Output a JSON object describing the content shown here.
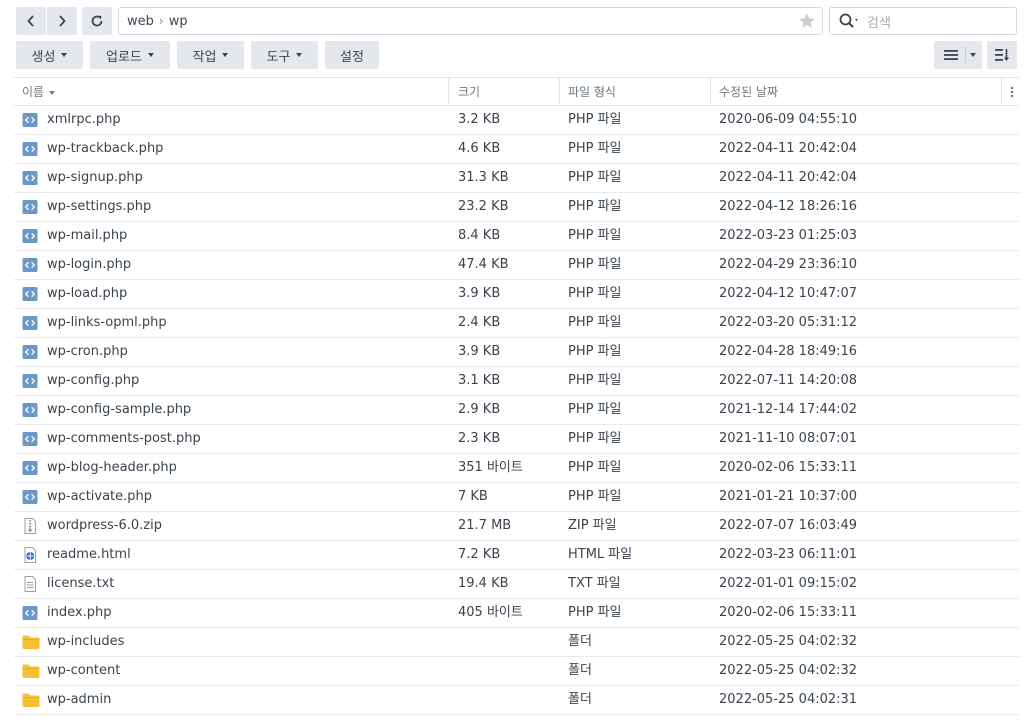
{
  "nav": {
    "path": [
      "web",
      "wp"
    ],
    "path_separator": "›",
    "search_placeholder": "검색"
  },
  "toolbar": {
    "create_label": "생성",
    "upload_label": "업로드",
    "action_label": "작업",
    "tools_label": "도구",
    "settings_label": "설정"
  },
  "table": {
    "columns": {
      "name": "이름",
      "size": "크기",
      "type": "파일 형식",
      "modified": "수정된 날짜"
    },
    "rows": [
      {
        "name": "xmlrpc.php",
        "size": "3.2 KB",
        "type": "PHP 파일",
        "modified": "2020-06-09 04:55:10",
        "icon": "php-file-icon"
      },
      {
        "name": "wp-trackback.php",
        "size": "4.6 KB",
        "type": "PHP 파일",
        "modified": "2022-04-11 20:42:04",
        "icon": "php-file-icon"
      },
      {
        "name": "wp-signup.php",
        "size": "31.3 KB",
        "type": "PHP 파일",
        "modified": "2022-04-11 20:42:04",
        "icon": "php-file-icon"
      },
      {
        "name": "wp-settings.php",
        "size": "23.2 KB",
        "type": "PHP 파일",
        "modified": "2022-04-12 18:26:16",
        "icon": "php-file-icon"
      },
      {
        "name": "wp-mail.php",
        "size": "8.4 KB",
        "type": "PHP 파일",
        "modified": "2022-03-23 01:25:03",
        "icon": "php-file-icon"
      },
      {
        "name": "wp-login.php",
        "size": "47.4 KB",
        "type": "PHP 파일",
        "modified": "2022-04-29 23:36:10",
        "icon": "php-file-icon"
      },
      {
        "name": "wp-load.php",
        "size": "3.9 KB",
        "type": "PHP 파일",
        "modified": "2022-04-12 10:47:07",
        "icon": "php-file-icon"
      },
      {
        "name": "wp-links-opml.php",
        "size": "2.4 KB",
        "type": "PHP 파일",
        "modified": "2022-03-20 05:31:12",
        "icon": "php-file-icon"
      },
      {
        "name": "wp-cron.php",
        "size": "3.9 KB",
        "type": "PHP 파일",
        "modified": "2022-04-28 18:49:16",
        "icon": "php-file-icon"
      },
      {
        "name": "wp-config.php",
        "size": "3.1 KB",
        "type": "PHP 파일",
        "modified": "2022-07-11 14:20:08",
        "icon": "php-file-icon"
      },
      {
        "name": "wp-config-sample.php",
        "size": "2.9 KB",
        "type": "PHP 파일",
        "modified": "2021-12-14 17:44:02",
        "icon": "php-file-icon"
      },
      {
        "name": "wp-comments-post.php",
        "size": "2.3 KB",
        "type": "PHP 파일",
        "modified": "2021-11-10 08:07:01",
        "icon": "php-file-icon"
      },
      {
        "name": "wp-blog-header.php",
        "size": "351 바이트",
        "type": "PHP 파일",
        "modified": "2020-02-06 15:33:11",
        "icon": "php-file-icon"
      },
      {
        "name": "wp-activate.php",
        "size": "7 KB",
        "type": "PHP 파일",
        "modified": "2021-01-21 10:37:00",
        "icon": "php-file-icon"
      },
      {
        "name": "wordpress-6.0.zip",
        "size": "21.7 MB",
        "type": "ZIP 파일",
        "modified": "2022-07-07 16:03:49",
        "icon": "zip-file-icon"
      },
      {
        "name": "readme.html",
        "size": "7.2 KB",
        "type": "HTML 파일",
        "modified": "2022-03-23 06:11:01",
        "icon": "html-file-icon"
      },
      {
        "name": "license.txt",
        "size": "19.4 KB",
        "type": "TXT 파일",
        "modified": "2022-01-01 09:15:02",
        "icon": "txt-file-icon"
      },
      {
        "name": "index.php",
        "size": "405 바이트",
        "type": "PHP 파일",
        "modified": "2020-02-06 15:33:11",
        "icon": "php-file-icon"
      },
      {
        "name": "wp-includes",
        "size": "",
        "type": "폴더",
        "modified": "2022-05-25 04:02:32",
        "icon": "folder-icon"
      },
      {
        "name": "wp-content",
        "size": "",
        "type": "폴더",
        "modified": "2022-05-25 04:02:32",
        "icon": "folder-icon"
      },
      {
        "name": "wp-admin",
        "size": "",
        "type": "폴더",
        "modified": "2022-05-25 04:02:31",
        "icon": "folder-icon"
      }
    ]
  },
  "colors": {
    "button_bg": "#e4e8ed",
    "php_icon": "#5b8fc7",
    "folder_icon": "#f5c033",
    "html_icon": "#2f6fd1"
  }
}
